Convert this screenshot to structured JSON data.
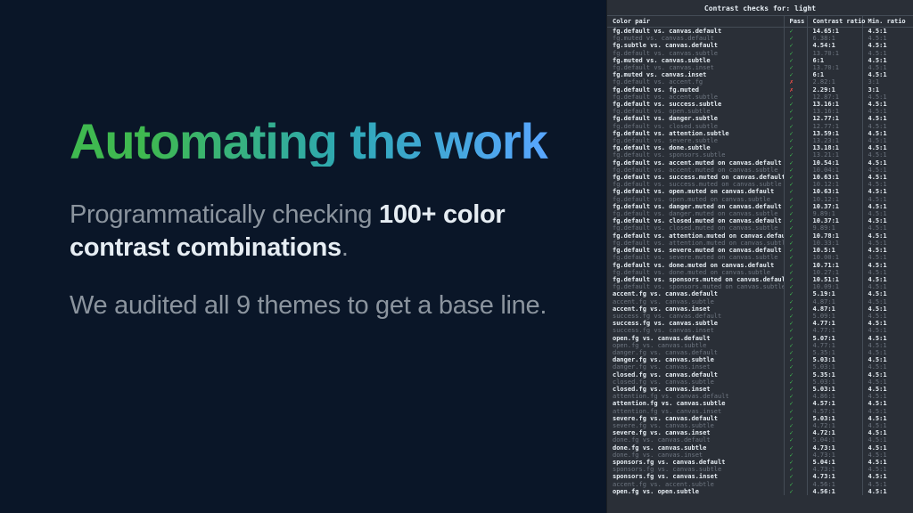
{
  "left": {
    "headline": "Automating the work",
    "sub1_pre": "Programmatically checking ",
    "sub1_bold": "100+ color contrast combinations",
    "sub1_post": ".",
    "sub2": "We audited all 9 themes to get a base line."
  },
  "terminal": {
    "title": "Contrast checks for: light",
    "cols": {
      "pair": "Color pair",
      "pass": "Pass",
      "ratio": "Contrast ratio",
      "min": "Min. ratio"
    },
    "rows": [
      {
        "b": 1,
        "p": 1,
        "pair": "fg.default vs. canvas.default",
        "ratio": "14.65:1",
        "min": "4.5:1"
      },
      {
        "b": 0,
        "p": 1,
        "pair": "fg.muted vs. canvas.default",
        "ratio": "6.38:1",
        "min": "4.5:1"
      },
      {
        "b": 1,
        "p": 1,
        "pair": "fg.subtle vs. canvas.default",
        "ratio": "4.54:1",
        "min": "4.5:1"
      },
      {
        "b": 0,
        "p": 1,
        "pair": "fg.default vs. canvas.subtle",
        "ratio": "13.70:1",
        "min": "4.5:1"
      },
      {
        "b": 1,
        "p": 1,
        "pair": "fg.muted vs. canvas.subtle",
        "ratio": "6:1",
        "min": "4.5:1"
      },
      {
        "b": 0,
        "p": 1,
        "pair": "fg.default vs. canvas.inset",
        "ratio": "13.70:1",
        "min": "4.5:1"
      },
      {
        "b": 1,
        "p": 1,
        "pair": "fg.muted vs. canvas.inset",
        "ratio": "6:1",
        "min": "4.5:1"
      },
      {
        "b": 0,
        "p": 0,
        "pair": "fg.default vs. accent.fg",
        "ratio": "2.82:1",
        "min": "3:1"
      },
      {
        "b": 1,
        "p": 0,
        "pair": "fg.default vs. fg.muted",
        "ratio": "2.29:1",
        "min": "3:1"
      },
      {
        "b": 0,
        "p": 1,
        "pair": "fg.default vs. accent.subtle",
        "ratio": "12.87:1",
        "min": "4.5:1"
      },
      {
        "b": 1,
        "p": 1,
        "pair": "fg.default vs. success.subtle",
        "ratio": "13.16:1",
        "min": "4.5:1"
      },
      {
        "b": 0,
        "p": 1,
        "pair": "fg.default vs. open.subtle",
        "ratio": "13.16:1",
        "min": "4.5:1"
      },
      {
        "b": 1,
        "p": 1,
        "pair": "fg.default vs. danger.subtle",
        "ratio": "12.77:1",
        "min": "4.5:1"
      },
      {
        "b": 0,
        "p": 1,
        "pair": "fg.default vs. closed.subtle",
        "ratio": "12.77:1",
        "min": "4.5:1"
      },
      {
        "b": 1,
        "p": 1,
        "pair": "fg.default vs. attention.subtle",
        "ratio": "13.59:1",
        "min": "4.5:1"
      },
      {
        "b": 0,
        "p": 1,
        "pair": "fg.default vs. severe.subtle",
        "ratio": "13.23:1",
        "min": "4.5:1"
      },
      {
        "b": 1,
        "p": 1,
        "pair": "fg.default vs. done.subtle",
        "ratio": "13.18:1",
        "min": "4.5:1"
      },
      {
        "b": 0,
        "p": 1,
        "pair": "fg.default vs. sponsors.subtle",
        "ratio": "13.21:1",
        "min": "4.5:1"
      },
      {
        "b": 1,
        "p": 1,
        "pair": "fg.default vs. accent.muted on canvas.default",
        "ratio": "10.54:1",
        "min": "4.5:1"
      },
      {
        "b": 0,
        "p": 1,
        "pair": "fg.default vs. accent.muted on canvas.subtle",
        "ratio": "10.04:1",
        "min": "4.5:1"
      },
      {
        "b": 1,
        "p": 1,
        "pair": "fg.default vs. success.muted on canvas.default",
        "ratio": "10.63:1",
        "min": "4.5:1"
      },
      {
        "b": 0,
        "p": 1,
        "pair": "fg.default vs. success.muted on canvas.subtle",
        "ratio": "10.12:1",
        "min": "4.5:1"
      },
      {
        "b": 1,
        "p": 1,
        "pair": "fg.default vs. open.muted on canvas.default",
        "ratio": "10.63:1",
        "min": "4.5:1"
      },
      {
        "b": 0,
        "p": 1,
        "pair": "fg.default vs. open.muted on canvas.subtle",
        "ratio": "10.12:1",
        "min": "4.5:1"
      },
      {
        "b": 1,
        "p": 1,
        "pair": "fg.default vs. danger.muted on canvas.default",
        "ratio": "10.37:1",
        "min": "4.5:1"
      },
      {
        "b": 0,
        "p": 1,
        "pair": "fg.default vs. danger.muted on canvas.subtle",
        "ratio": "9.89:1",
        "min": "4.5:1"
      },
      {
        "b": 1,
        "p": 1,
        "pair": "fg.default vs. closed.muted on canvas.default",
        "ratio": "10.37:1",
        "min": "4.5:1"
      },
      {
        "b": 0,
        "p": 1,
        "pair": "fg.default vs. closed.muted on canvas.subtle",
        "ratio": "9.89:1",
        "min": "4.5:1"
      },
      {
        "b": 1,
        "p": 1,
        "pair": "fg.default vs. attention.muted on canvas.default",
        "ratio": "10.78:1",
        "min": "4.5:1"
      },
      {
        "b": 0,
        "p": 1,
        "pair": "fg.default vs. attention.muted on canvas.subtle",
        "ratio": "10.33:1",
        "min": "4.5:1"
      },
      {
        "b": 1,
        "p": 1,
        "pair": "fg.default vs. severe.muted on canvas.default",
        "ratio": "10.5:1",
        "min": "4.5:1"
      },
      {
        "b": 0,
        "p": 1,
        "pair": "fg.default vs. severe.muted on canvas.subtle",
        "ratio": "10.00:1",
        "min": "4.5:1"
      },
      {
        "b": 1,
        "p": 1,
        "pair": "fg.default vs. done.muted on canvas.default",
        "ratio": "10.71:1",
        "min": "4.5:1"
      },
      {
        "b": 0,
        "p": 1,
        "pair": "fg.default vs. done.muted on canvas.subtle",
        "ratio": "10.27:1",
        "min": "4.5:1"
      },
      {
        "b": 1,
        "p": 1,
        "pair": "fg.default vs. sponsors.muted on canvas.default",
        "ratio": "10.51:1",
        "min": "4.5:1"
      },
      {
        "b": 0,
        "p": 1,
        "pair": "fg.default vs. sponsors.muted on canvas.subtle",
        "ratio": "10.09:1",
        "min": "4.5:1"
      },
      {
        "b": 1,
        "p": 1,
        "pair": "accent.fg vs. canvas.default",
        "ratio": "5.19:1",
        "min": "4.5:1"
      },
      {
        "b": 0,
        "p": 1,
        "pair": "accent.fg vs. canvas.subtle",
        "ratio": "4.87:1",
        "min": "4.5:1"
      },
      {
        "b": 1,
        "p": 1,
        "pair": "accent.fg vs. canvas.inset",
        "ratio": "4.87:1",
        "min": "4.5:1"
      },
      {
        "b": 0,
        "p": 1,
        "pair": "success.fg vs. canvas.default",
        "ratio": "5.09:1",
        "min": "4.5:1"
      },
      {
        "b": 1,
        "p": 1,
        "pair": "success.fg vs. canvas.subtle",
        "ratio": "4.77:1",
        "min": "4.5:1"
      },
      {
        "b": 0,
        "p": 1,
        "pair": "success.fg vs. canvas.inset",
        "ratio": "4.77:1",
        "min": "4.5:1"
      },
      {
        "b": 1,
        "p": 1,
        "pair": "open.fg vs. canvas.default",
        "ratio": "5.07:1",
        "min": "4.5:1"
      },
      {
        "b": 0,
        "p": 1,
        "pair": "open.fg vs. canvas.subtle",
        "ratio": "4.77:1",
        "min": "4.5:1"
      },
      {
        "b": 0,
        "p": 1,
        "pair": "danger.fg vs. canvas.default",
        "ratio": "5.35:1",
        "min": "4.5:1"
      },
      {
        "b": 1,
        "p": 1,
        "pair": "danger.fg vs. canvas.subtle",
        "ratio": "5.03:1",
        "min": "4.5:1"
      },
      {
        "b": 0,
        "p": 1,
        "pair": "danger.fg vs. canvas.inset",
        "ratio": "5.03:1",
        "min": "4.5:1"
      },
      {
        "b": 1,
        "p": 1,
        "pair": "closed.fg vs. canvas.default",
        "ratio": "5.35:1",
        "min": "4.5:1"
      },
      {
        "b": 0,
        "p": 1,
        "pair": "closed.fg vs. canvas.subtle",
        "ratio": "5.03:1",
        "min": "4.5:1"
      },
      {
        "b": 1,
        "p": 1,
        "pair": "closed.fg vs. canvas.inset",
        "ratio": "5.03:1",
        "min": "4.5:1"
      },
      {
        "b": 0,
        "p": 1,
        "pair": "attention.fg vs. canvas.default",
        "ratio": "4.86:1",
        "min": "4.5:1"
      },
      {
        "b": 1,
        "p": 1,
        "pair": "attention.fg vs. canvas.subtle",
        "ratio": "4.57:1",
        "min": "4.5:1"
      },
      {
        "b": 0,
        "p": 1,
        "pair": "attention.fg vs. canvas.inset",
        "ratio": "4.57:1",
        "min": "4.5:1"
      },
      {
        "b": 1,
        "p": 1,
        "pair": "severe.fg vs. canvas.default",
        "ratio": "5.03:1",
        "min": "4.5:1"
      },
      {
        "b": 0,
        "p": 1,
        "pair": "severe.fg vs. canvas.subtle",
        "ratio": "4.72:1",
        "min": "4.5:1"
      },
      {
        "b": 1,
        "p": 1,
        "pair": "severe.fg vs. canvas.inset",
        "ratio": "4.72:1",
        "min": "4.5:1"
      },
      {
        "b": 0,
        "p": 1,
        "pair": "done.fg vs. canvas.default",
        "ratio": "5.04:1",
        "min": "4.5:1"
      },
      {
        "b": 1,
        "p": 1,
        "pair": "done.fg vs. canvas.subtle",
        "ratio": "4.73:1",
        "min": "4.5:1"
      },
      {
        "b": 0,
        "p": 1,
        "pair": "done.fg vs. canvas.inset",
        "ratio": "4.73:1",
        "min": "4.5:1"
      },
      {
        "b": 1,
        "p": 1,
        "pair": "sponsors.fg vs. canvas.default",
        "ratio": "5.04:1",
        "min": "4.5:1"
      },
      {
        "b": 0,
        "p": 1,
        "pair": "sponsors.fg vs. canvas.subtle",
        "ratio": "4.73:1",
        "min": "4.5:1"
      },
      {
        "b": 1,
        "p": 1,
        "pair": "sponsors.fg vs. canvas.inset",
        "ratio": "4.73:1",
        "min": "4.5:1"
      },
      {
        "b": 0,
        "p": 1,
        "pair": "accent.fg vs. accent.subtle",
        "ratio": "4.56:1",
        "min": "4.5:1"
      },
      {
        "b": 1,
        "p": 1,
        "pair": "open.fg vs. open.subtle",
        "ratio": "4.56:1",
        "min": "4.5:1"
      }
    ]
  }
}
